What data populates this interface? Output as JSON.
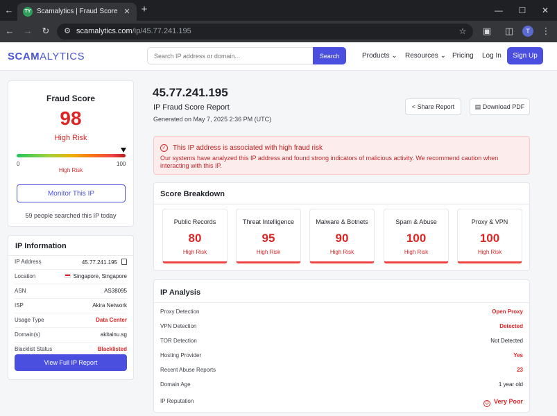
{
  "browser": {
    "tab_title": "Scamalytics | Fraud Score Check",
    "url_domain": "scamalytics.com",
    "url_path": "/ip/45.77.241.195",
    "profile_initial": "T",
    "favicon_text": "TY"
  },
  "header": {
    "logo_a": "SCAM",
    "logo_b": "ALYTICS",
    "search_placeholder": "Search IP address or domain...",
    "search_label": "Search",
    "menu": {
      "products": "Products ⌄",
      "resources": "Resources ⌄",
      "pricing": "Pricing",
      "login": "Log In"
    },
    "signup_label": "Sign Up"
  },
  "fraud": {
    "title": "Fraud Score",
    "score": "98",
    "risk": "High Risk",
    "gauge_min": "0",
    "gauge_max": "100",
    "gauge_caption": "High Risk",
    "gauge_level_pct": 98,
    "monitor_label": "Monitor This IP",
    "searched": "59 people searched this IP today"
  },
  "ip_info": {
    "title": "IP Information",
    "rows": [
      {
        "k": "IP Address",
        "v": "45.77.241.195"
      },
      {
        "k": "Location",
        "v": "Singapore, Singapore"
      },
      {
        "k": "ASN",
        "v": "AS38095"
      },
      {
        "k": "ISP",
        "v": "Akira Network"
      },
      {
        "k": "Usage Type",
        "v": "Data Center"
      },
      {
        "k": "Domain(s)",
        "v": "akitainu.sg"
      },
      {
        "k": "Blacklist Status",
        "v": "Blacklisted"
      }
    ],
    "full_report_label": "View Full IP Report"
  },
  "main": {
    "ip": "45.77.241.195",
    "subtitle": "IP Fraud Score Report",
    "generated": "Generated on May 7, 2025 2:36 PM (UTC)",
    "share_label": "Share Report",
    "pdf_label": "Download PDF"
  },
  "alert": {
    "title": "This IP address is associated with high fraud risk",
    "text": "Our systems have analyzed this IP address and found strong indicators of malicious activity. We recommend caution when interacting with this IP."
  },
  "breakdown": {
    "title": "Score Breakdown",
    "items": [
      {
        "label": "Public Records",
        "score": "80",
        "risk": "High Risk"
      },
      {
        "label": "Threat Intelligence",
        "score": "95",
        "risk": "High Risk"
      },
      {
        "label": "Malware & Botnets",
        "score": "90",
        "risk": "High Risk"
      },
      {
        "label": "Spam & Abuse",
        "score": "100",
        "risk": "High Risk"
      },
      {
        "label": "Proxy & VPN",
        "score": "100",
        "risk": "High Risk"
      }
    ]
  },
  "analysis": {
    "title": "IP Analysis",
    "rows": [
      {
        "k": "Proxy Detection",
        "v": "Open Proxy"
      },
      {
        "k": "VPN Detection",
        "v": "Detected"
      },
      {
        "k": "TOR Detection",
        "v": "Not Detected"
      },
      {
        "k": "Hosting Provider",
        "v": "Yes"
      },
      {
        "k": "Recent Abuse Reports",
        "v": "23"
      },
      {
        "k": "Domain Age",
        "v": "1 year old"
      },
      {
        "k": "IP Reputation",
        "v": "Very Poor"
      }
    ]
  },
  "colors": {
    "accent": "#4a4fe0",
    "danger": "#dc2626",
    "alert_bg": "#fdecec"
  }
}
